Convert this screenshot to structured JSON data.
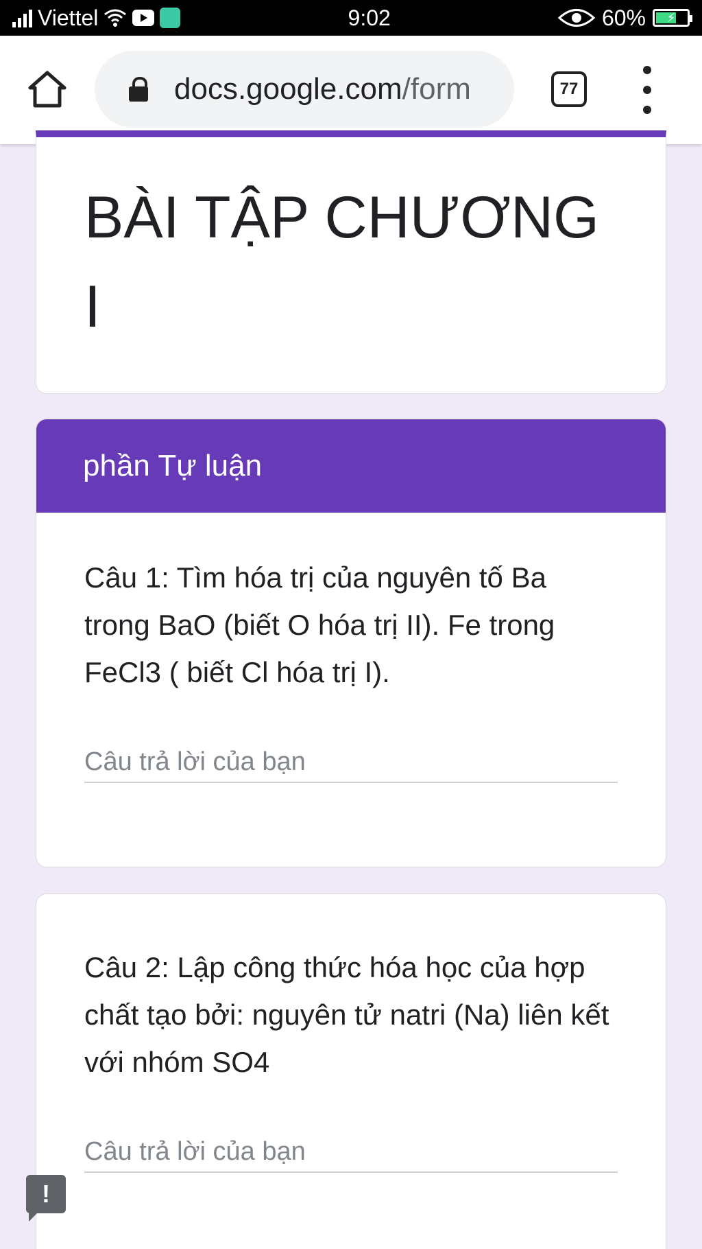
{
  "status_bar": {
    "carrier": "Viettel",
    "time": "9:02",
    "battery": "60%"
  },
  "browser": {
    "url_domain": "docs.google.com",
    "url_path": "/form",
    "tab_count": "77"
  },
  "form": {
    "title": "BÀI TẬP CHƯƠNG I"
  },
  "section": {
    "title": "phần Tự luận"
  },
  "questions": [
    {
      "text": "Câu 1: Tìm hóa trị của nguyên tố Ba trong BaO (biết O hóa trị II). Fe trong FeCl3 ( biết Cl hóa trị I).",
      "placeholder": "Câu trả lời của bạn"
    },
    {
      "text": "Câu 2: Lập công thức hóa học của hợp chất tạo bởi: nguyên tử natri (Na) liên kết với nhóm SO4",
      "placeholder": "Câu trả lời của bạn"
    }
  ],
  "colors": {
    "accent": "#673ab7",
    "page_background": "#efe9f8"
  },
  "icons": {
    "home": "home-icon",
    "lock": "lock-icon",
    "menu": "more-vert-icon",
    "feedback": "feedback-icon"
  }
}
